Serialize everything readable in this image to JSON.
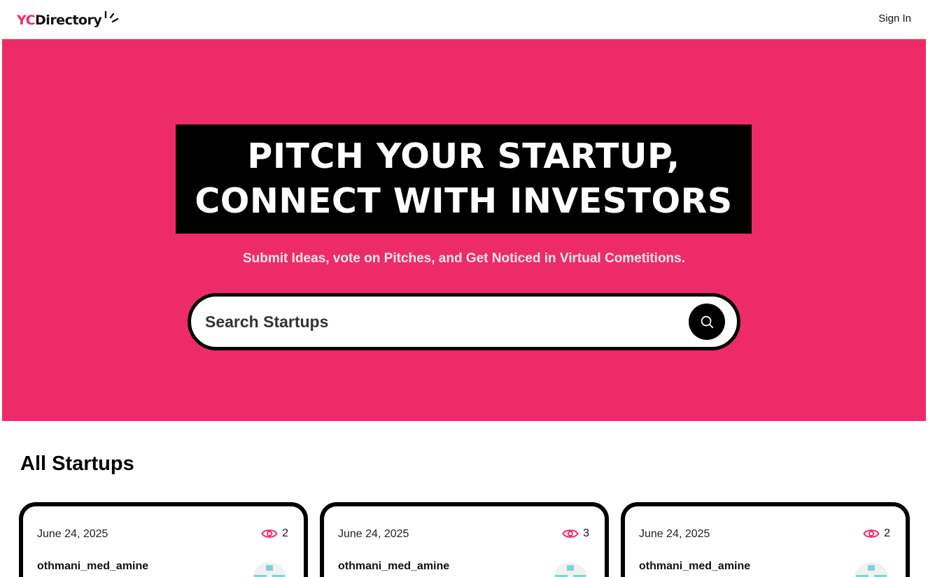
{
  "navbar": {
    "logo_accent": "YC",
    "logo_text": "Directory",
    "signin_label": "Sign In"
  },
  "hero": {
    "headline_line1": "PITCH YOUR STARTUP,",
    "headline_line2": "CONNECT WITH INVESTORS",
    "subtitle": "Submit Ideas, vote on Pitches, and Get Noticed in Virtual Cometitions.",
    "search_placeholder": "Search Startups",
    "search_icon": "search-icon"
  },
  "startups": {
    "title": "All Startups",
    "cards": [
      {
        "date": "June 24, 2025",
        "views": "2",
        "author": "othmani_med_amine"
      },
      {
        "date": "June 24, 2025",
        "views": "3",
        "author": "othmani_med_amine"
      },
      {
        "date": "June 24, 2025",
        "views": "2",
        "author": "othmani_med_amine"
      }
    ]
  },
  "colors": {
    "brand_pink": "#EE2B69",
    "black": "#000000",
    "white": "#FFFFFF"
  }
}
